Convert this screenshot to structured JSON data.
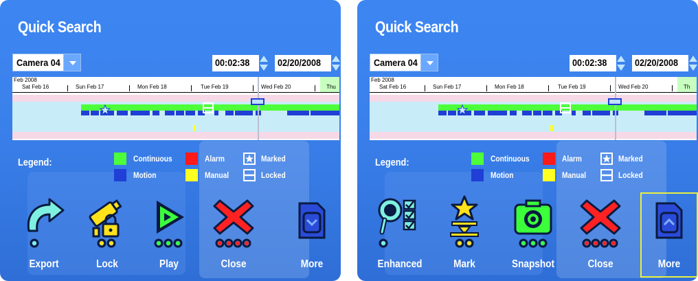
{
  "screens": [
    {
      "title": "Quick Search",
      "camera": "Camera 04",
      "time": "00:02:38",
      "date": "02/20/2008",
      "timeline": {
        "month": "Feb 2008",
        "days": [
          "Sat Feb 16",
          "Sun Feb 17",
          "Mon Feb 18",
          "Tue Feb 19",
          "Wed Feb 20",
          "Thu"
        ]
      },
      "legend": {
        "label": "Legend:",
        "continuous": "Continuous",
        "alarm": "Alarm",
        "marked": "Marked",
        "motion": "Motion",
        "manual": "Manual",
        "locked": "Locked"
      },
      "buttons": [
        {
          "label": "Export",
          "icon": "export-arrow-icon"
        },
        {
          "label": "Lock",
          "icon": "lock-camera-icon"
        },
        {
          "label": "Play",
          "icon": "play-icon"
        },
        {
          "label": "Close",
          "icon": "close-x-icon"
        },
        {
          "label": "More",
          "icon": "more-down-icon"
        }
      ]
    },
    {
      "title": "Quick Search",
      "camera": "Camera 04",
      "time": "00:02:38",
      "date": "02/20/2008",
      "timeline": {
        "month": "Feb 2008",
        "days": [
          "Sat Feb 16",
          "Sun Feb 17",
          "Mon Feb 18",
          "Tue Feb 19",
          "Wed Feb 20",
          "Th"
        ]
      },
      "legend": {
        "label": "Legend:",
        "continuous": "Continuous",
        "alarm": "Alarm",
        "marked": "Marked",
        "motion": "Motion",
        "manual": "Manual",
        "locked": "Locked"
      },
      "buttons": [
        {
          "label": "Enhanced",
          "icon": "enhanced-search-icon"
        },
        {
          "label": "Mark",
          "icon": "mark-star-icon"
        },
        {
          "label": "Snapshot",
          "icon": "camera-snapshot-icon"
        },
        {
          "label": "Close",
          "icon": "close-x-icon"
        },
        {
          "label": "More",
          "icon": "more-up-icon"
        }
      ]
    }
  ],
  "colors": {
    "continuous": "#4dff3a",
    "motion": "#1f3fd6",
    "alarm": "#ff1a1a",
    "manual": "#ffff22",
    "icon_cyan": "#7ff0e0",
    "icon_yellow": "#ffe21a",
    "icon_green": "#3cff3c",
    "icon_red": "#ff2222",
    "icon_blue": "#2a4bd8"
  }
}
